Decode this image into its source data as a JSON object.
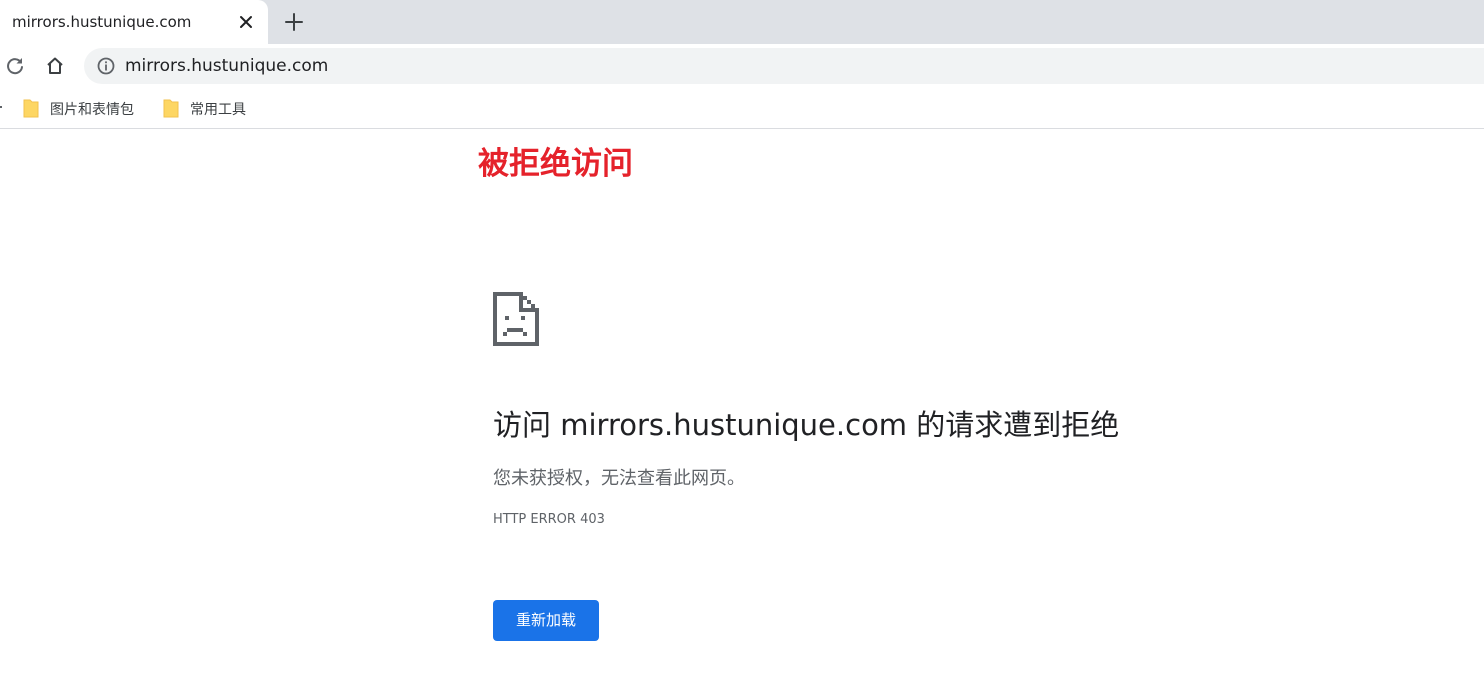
{
  "tab": {
    "title": "mirrors.hustunique.com",
    "icons": {
      "close": "close-icon",
      "new_tab": "plus-icon",
      "favicon": "broken-page-favicon"
    }
  },
  "toolbar": {
    "url": "mirrors.hustunique.com",
    "icons": {
      "reload": "reload-icon",
      "home": "home-icon",
      "site_info": "info-icon"
    }
  },
  "bookmarks": {
    "items": [
      {
        "label": "图片和表情包",
        "icon": "folder-icon"
      },
      {
        "label": "常用工具",
        "icon": "folder-icon"
      }
    ]
  },
  "page": {
    "annotation": "被拒绝访问",
    "error_icon": "sad-document-icon",
    "heading": "访问 mirrors.hustunique.com 的请求遭到拒绝",
    "subtext": "您未获授权，无法查看此网页。",
    "error_code": "HTTP ERROR 403",
    "reload_button": "重新加载"
  },
  "colors": {
    "annotation": "#e5222b",
    "button": "#1a73e8",
    "folder": "#fdd663",
    "tabstrip": "#dee1e6"
  }
}
